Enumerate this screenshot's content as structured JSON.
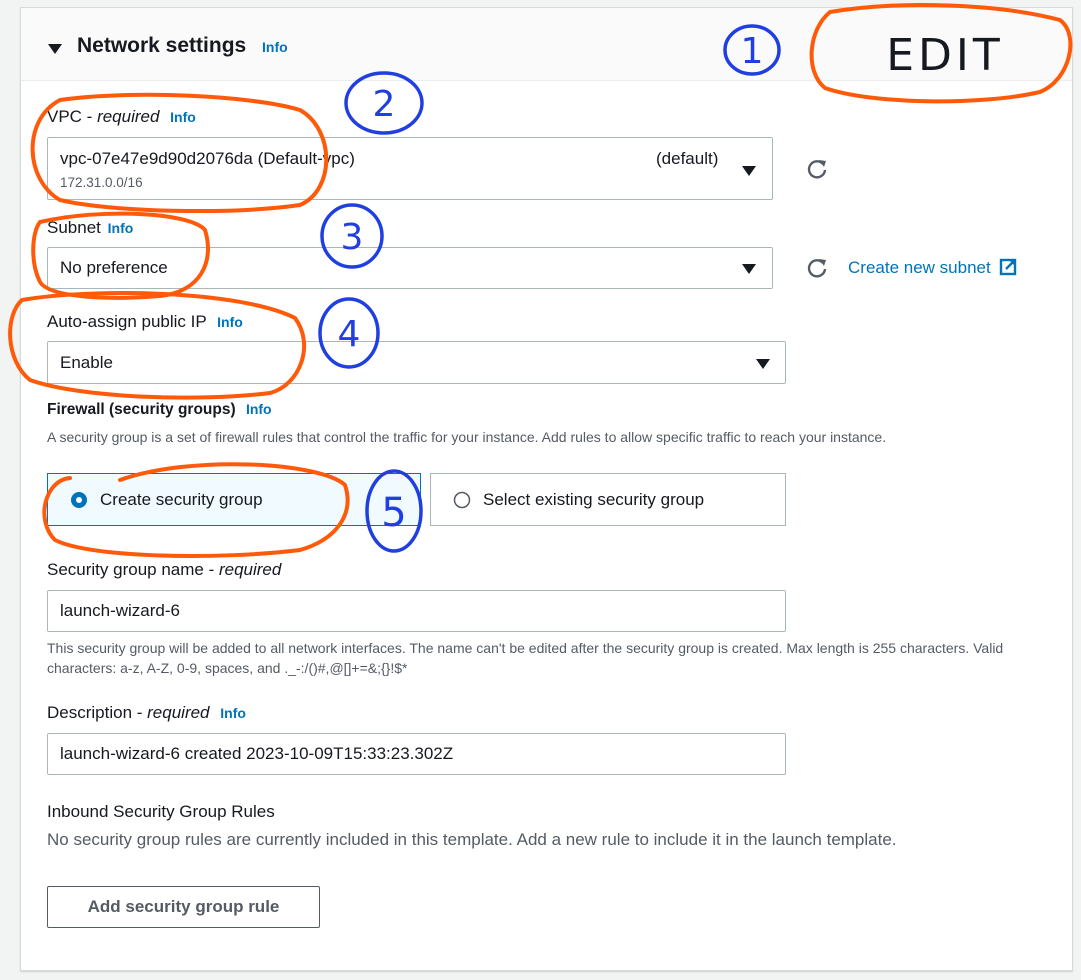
{
  "header": {
    "title": "Network settings",
    "info": "Info"
  },
  "vpc": {
    "label": "VPC - ",
    "label_em": "required",
    "info": "Info",
    "value": "vpc-07e47e9d90d2076da (Default-vpc)",
    "tag": "(default)",
    "cidr": "172.31.0.0/16"
  },
  "subnet": {
    "label": "Subnet",
    "info": "Info",
    "value": "No preference",
    "create_link": "Create new subnet"
  },
  "auto_ip": {
    "label": "Auto-assign public IP",
    "info": "Info",
    "value": "Enable"
  },
  "firewall": {
    "label": "Firewall (security groups)",
    "info": "Info",
    "description": "A security group is a set of firewall rules that control the traffic for your instance. Add rules to allow specific traffic to reach your instance.",
    "option_create": "Create security group",
    "option_existing": "Select existing security group"
  },
  "sg_name": {
    "label": "Security group name - ",
    "label_em": "required",
    "value": "launch-wizard-6",
    "help": "This security group will be added to all network interfaces. The name can't be edited after the security group is created. Max length is 255 characters. Valid characters: a-z, A-Z, 0-9, spaces, and ._-:/()#,@[]+=&;{}!$*"
  },
  "description": {
    "label": "Description - ",
    "label_em": "required",
    "info": "Info",
    "value": "launch-wizard-6 created 2023-10-09T15:33:23.302Z"
  },
  "inbound": {
    "title": "Inbound Security Group Rules",
    "empty": "No security group rules are currently included in this template. Add a new rule to include it in the launch template.",
    "add_button": "Add security group rule"
  },
  "annotations": {
    "n1": "1",
    "n2": "2",
    "n3": "3",
    "n4": "4",
    "n5": "5",
    "edit": "EDIT"
  },
  "colors": {
    "link": "#0073bb",
    "annot_orange": "#ff5a0a",
    "annot_blue": "#1f3fe0"
  }
}
